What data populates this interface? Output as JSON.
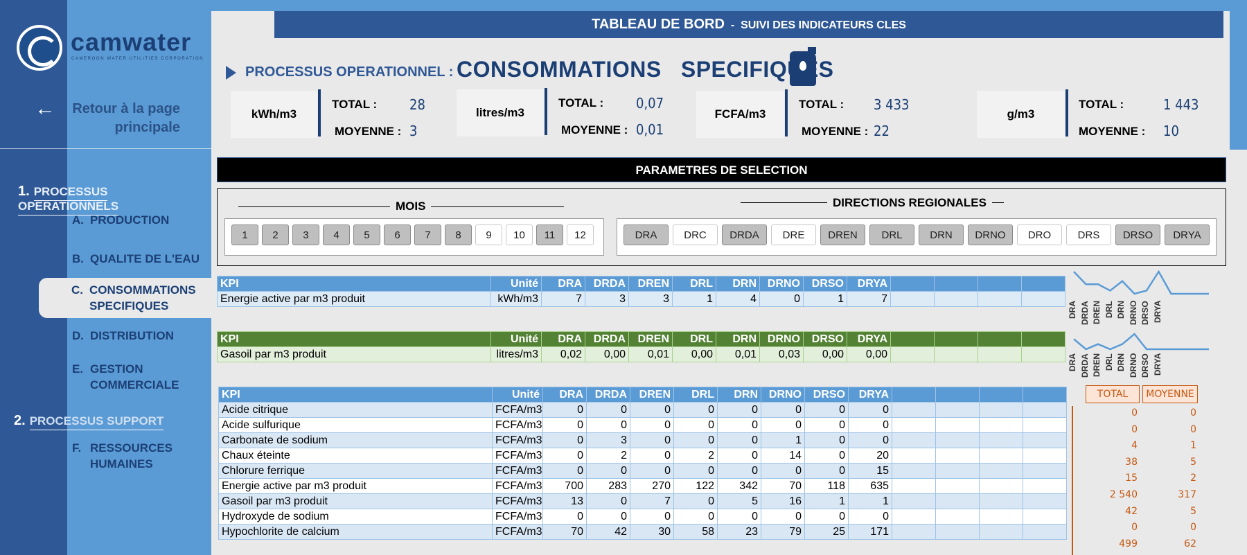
{
  "brand": {
    "name": "camwater",
    "tagline": "CAMEROON WATER UTILITIES CORPORATION"
  },
  "back": {
    "arrow": "←",
    "label_line1": "Retour à la page",
    "label_line2": "principale"
  },
  "nav": {
    "section1": {
      "num": "1.",
      "label": "PROCESSUS OPERATIONNELS"
    },
    "section2": {
      "num": "2.",
      "label": "PROCESSUS SUPPORT"
    },
    "items": [
      {
        "letter": "A.",
        "line1": "PRODUCTION",
        "line2": ""
      },
      {
        "letter": "B.",
        "line1": "QUALITE DE L'EAU",
        "line2": ""
      },
      {
        "letter": "C.",
        "line1": "CONSOMMATIONS",
        "line2": "SPECIFIQUES"
      },
      {
        "letter": "D.",
        "line1": "DISTRIBUTION",
        "line2": ""
      },
      {
        "letter": "E.",
        "line1": "GESTION",
        "line2": "COMMERCIALE"
      },
      {
        "letter": "F.",
        "line1": "RESSOURCES",
        "line2": "HUMAINES"
      }
    ]
  },
  "header": {
    "title": "TABLEAU DE BORD",
    "sep": "-",
    "subtitle": "SUIVI DES INDICATEURS CLES"
  },
  "process": {
    "label": "PROCESSUS OPERATIONNEL :",
    "name": "CONSOMMATIONS   SPECIFIQUES",
    "icon": "jerrycan-icon"
  },
  "kpi_cards": [
    {
      "unit": "kWh/m3",
      "total_label": "TOTAL :",
      "total": "28",
      "avg_label": "MOYENNE :",
      "avg": "3"
    },
    {
      "unit": "litres/m3",
      "total_label": "TOTAL :",
      "total": "0,07",
      "avg_label": "MOYENNE :",
      "avg": "0,01"
    },
    {
      "unit": "FCFA/m3",
      "total_label": "TOTAL :",
      "total": "3 433",
      "avg_label": "MOYENNE :",
      "avg": "22"
    },
    {
      "unit": "g/m3",
      "total_label": "TOTAL :",
      "total": "1 443",
      "avg_label": "MOYENNE :",
      "avg": "10"
    }
  ],
  "selection": {
    "title": "PARAMETRES DE SELECTION",
    "months_title": "MOIS",
    "months": [
      {
        "label": "1",
        "selected": false
      },
      {
        "label": "2",
        "selected": false
      },
      {
        "label": "3",
        "selected": false
      },
      {
        "label": "4",
        "selected": false
      },
      {
        "label": "5",
        "selected": false
      },
      {
        "label": "6",
        "selected": false
      },
      {
        "label": "7",
        "selected": false
      },
      {
        "label": "8",
        "selected": false
      },
      {
        "label": "9",
        "selected": true
      },
      {
        "label": "10",
        "selected": true
      },
      {
        "label": "11",
        "selected": false
      },
      {
        "label": "12",
        "selected": true
      }
    ],
    "regions_title": "DIRECTIONS REGIONALES",
    "regions": [
      {
        "label": "DRA",
        "selected": false
      },
      {
        "label": "DRC",
        "selected": true
      },
      {
        "label": "DRDA",
        "selected": false
      },
      {
        "label": "DRE",
        "selected": true
      },
      {
        "label": "DREN",
        "selected": false
      },
      {
        "label": "DRL",
        "selected": false
      },
      {
        "label": "DRN",
        "selected": false
      },
      {
        "label": "DRNO",
        "selected": false
      },
      {
        "label": "DRO",
        "selected": true
      },
      {
        "label": "DRS",
        "selected": true
      },
      {
        "label": "DRSO",
        "selected": false
      },
      {
        "label": "DRYA",
        "selected": false
      }
    ]
  },
  "tables": {
    "columns": [
      "KPI",
      "Unité",
      "DRA",
      "DRDA",
      "DREN",
      "DRL",
      "DRN",
      "DRNO",
      "DRSO",
      "DRYA"
    ],
    "energy": {
      "rows": [
        [
          "Energie active par m3 produit",
          "kWh/m3",
          "7",
          "3",
          "3",
          "1",
          "4",
          "0",
          "1",
          "7"
        ]
      ]
    },
    "gasoil": {
      "rows": [
        [
          "Gasoil par m3 produit",
          "litres/m3",
          "0,02",
          "0,00",
          "0,01",
          "0,00",
          "0,01",
          "0,03",
          "0,00",
          "0,00"
        ]
      ]
    },
    "cost": {
      "rows": [
        [
          "Acide citrique",
          "FCFA/m3",
          "0",
          "0",
          "0",
          "0",
          "0",
          "0",
          "0",
          "0"
        ],
        [
          "Acide sulfurique",
          "FCFA/m3",
          "0",
          "0",
          "0",
          "0",
          "0",
          "0",
          "0",
          "0"
        ],
        [
          "Carbonate de sodium",
          "FCFA/m3",
          "0",
          "3",
          "0",
          "0",
          "0",
          "1",
          "0",
          "0"
        ],
        [
          "Chaux éteinte",
          "FCFA/m3",
          "0",
          "2",
          "0",
          "2",
          "0",
          "14",
          "0",
          "20"
        ],
        [
          "Chlorure ferrique",
          "FCFA/m3",
          "0",
          "0",
          "0",
          "0",
          "0",
          "0",
          "0",
          "15"
        ],
        [
          "Energie active par m3 produit",
          "FCFA/m3",
          "700",
          "283",
          "270",
          "122",
          "342",
          "70",
          "118",
          "635"
        ],
        [
          "Gasoil par m3 produit",
          "FCFA/m3",
          "13",
          "0",
          "7",
          "0",
          "5",
          "16",
          "1",
          "1"
        ],
        [
          "Hydroxyde de sodium",
          "FCFA/m3",
          "0",
          "0",
          "0",
          "0",
          "0",
          "0",
          "0",
          "0"
        ],
        [
          "Hypochlorite de calcium",
          "FCFA/m3",
          "70",
          "42",
          "30",
          "58",
          "23",
          "79",
          "25",
          "171"
        ]
      ]
    }
  },
  "totals": {
    "total_label": "TOTAL",
    "avg_label": "MOYENNE",
    "rows": [
      [
        "0",
        "0"
      ],
      [
        "0",
        "0"
      ],
      [
        "4",
        "1"
      ],
      [
        "38",
        "5"
      ],
      [
        "15",
        "2"
      ],
      [
        "2 540",
        "317"
      ],
      [
        "42",
        "5"
      ],
      [
        "0",
        "0"
      ],
      [
        "499",
        "62"
      ]
    ]
  },
  "sparklines": {
    "labels": [
      "DRA",
      "DRDA",
      "DREN",
      "DRL",
      "DRN",
      "DRNO",
      "DRSO",
      "DRYA"
    ],
    "energy_values": [
      7,
      3,
      3,
      1,
      4,
      0,
      1,
      7
    ],
    "gasoil_values": [
      0.02,
      0.0,
      0.01,
      0.0,
      0.01,
      0.03,
      0.0,
      0.0
    ],
    "color": "#5b9bd5"
  }
}
